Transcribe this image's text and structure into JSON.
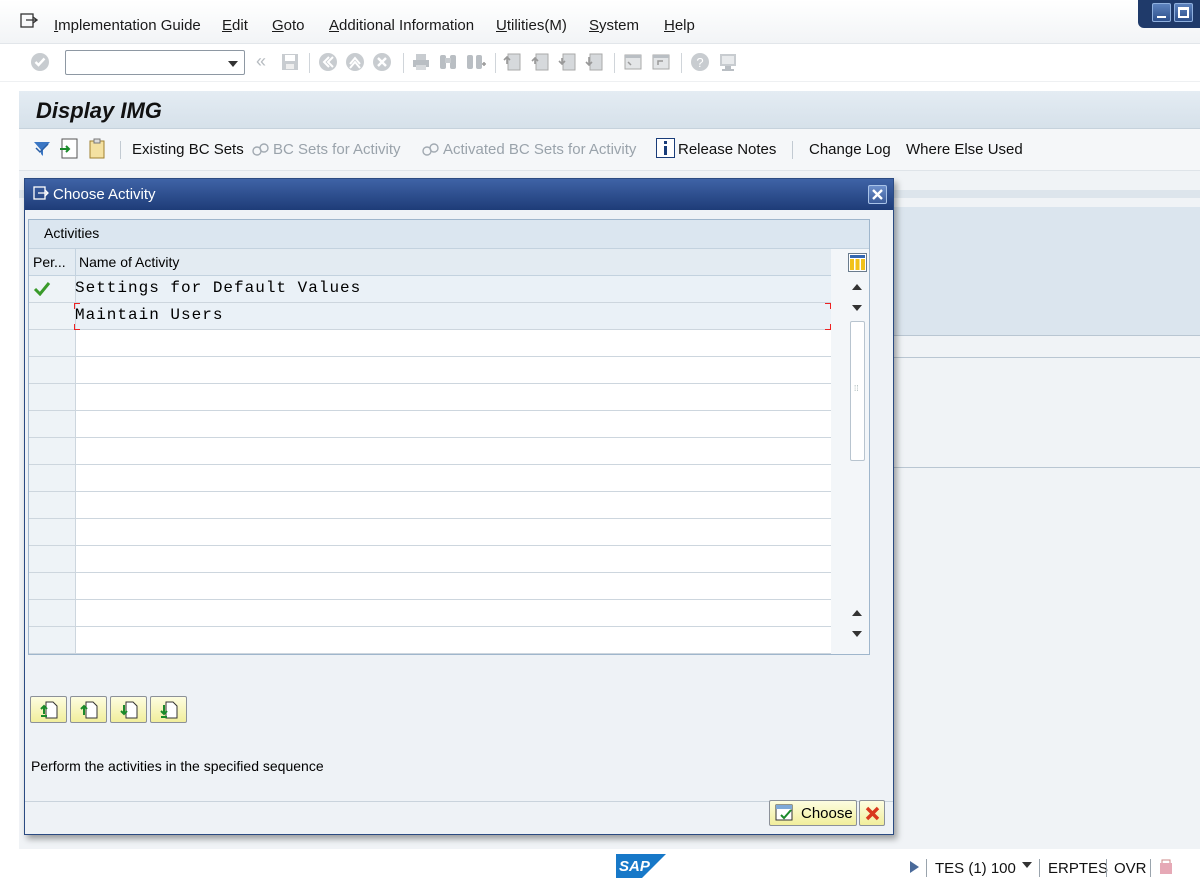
{
  "menubar": {
    "items": [
      "Implementation Guide",
      "Edit",
      "Goto",
      "Additional Information",
      "Utilities(M)",
      "System",
      "Help"
    ]
  },
  "std_toolbar": {
    "command_field_value": "",
    "icons": [
      "enter-icon",
      "back-icon",
      "save-icon",
      "back-nav-icon",
      "exit-icon",
      "cancel-icon",
      "print-icon",
      "find-icon",
      "find-next-icon",
      "first-page-icon",
      "previous-page-icon",
      "next-page-icon",
      "last-page-icon",
      "new-session-icon",
      "shortcut-icon",
      "help-icon",
      "customize-layout-icon"
    ]
  },
  "screen": {
    "title": "Display IMG"
  },
  "app_toolbar": {
    "existing_bc_sets": "Existing BC Sets",
    "bc_sets_for_activity": "BC Sets for Activity",
    "activated_bc_sets": "Activated BC Sets for Activity",
    "release_notes": "Release Notes",
    "change_log": "Change Log",
    "where_else_used": "Where Else Used"
  },
  "dialog": {
    "title": "Choose Activity",
    "table_caption": "Activities",
    "columns": [
      "Per...",
      "Name of Activity"
    ],
    "rows": [
      {
        "performed": true,
        "name": "Settings for Default Values"
      },
      {
        "performed": false,
        "name": "Maintain Users"
      }
    ],
    "empty_rows": 12,
    "hint": "Perform the activities in the specified sequence",
    "choose_label": "Choose",
    "nav_buttons": [
      "first-entry-icon",
      "previous-entry-icon",
      "next-entry-icon",
      "last-entry-icon"
    ]
  },
  "statusbar": {
    "system": "TES (1) 100",
    "server": "ERPTES",
    "mode": "OVR",
    "logo_text": "SAP"
  },
  "colors": {
    "dialog_title": "#1e3c78",
    "check_green": "#3a9a2a",
    "button_yellow": "#f1ee9c"
  }
}
